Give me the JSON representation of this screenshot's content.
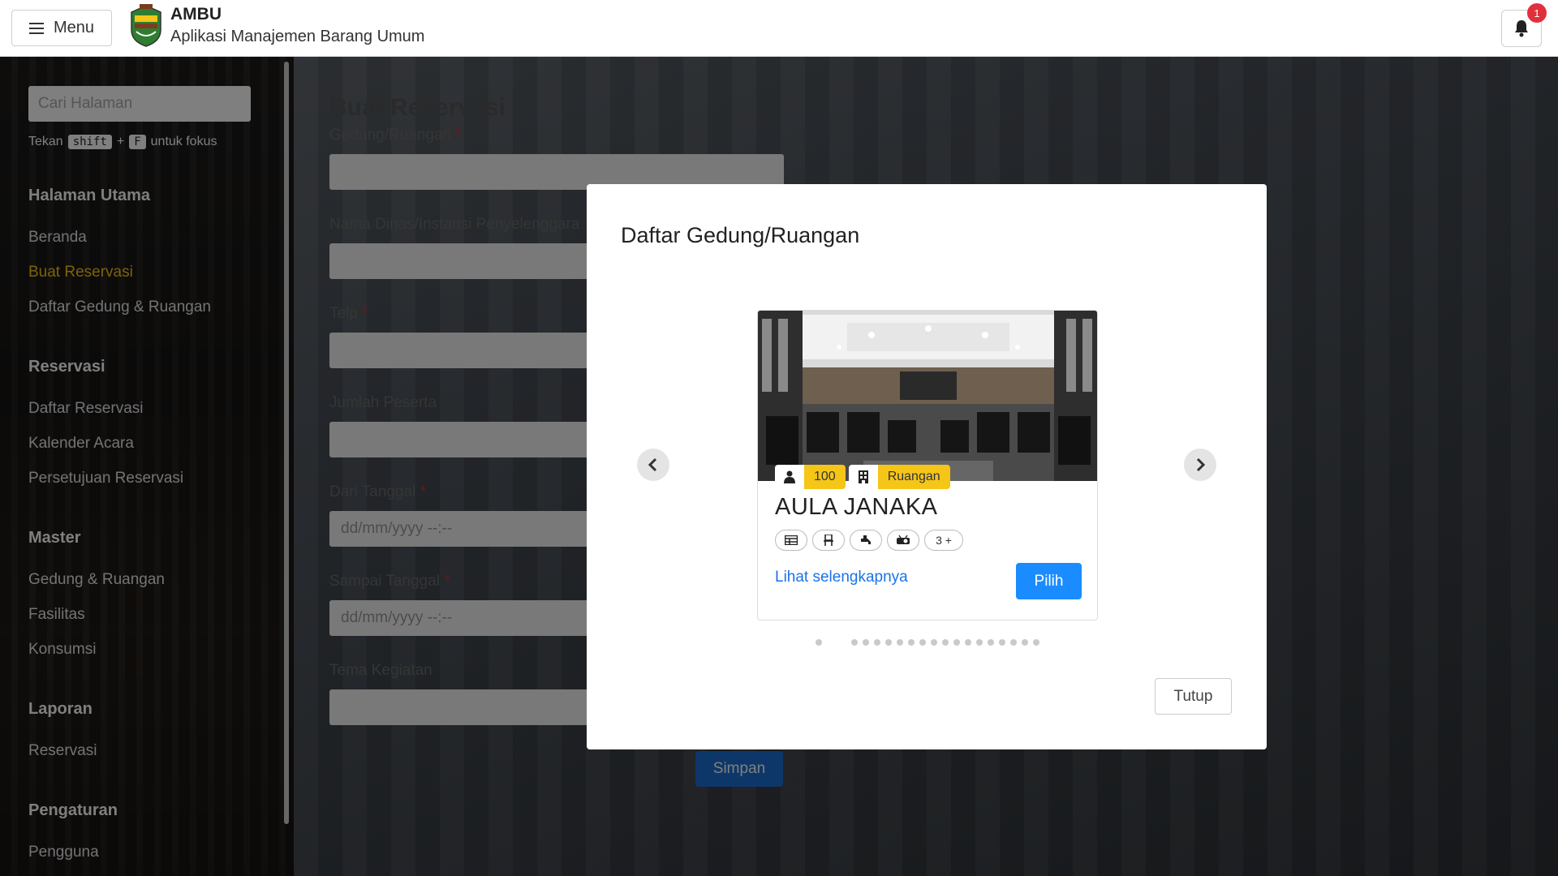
{
  "header": {
    "menu_label": "Menu",
    "app_title": "AMBU",
    "app_subtitle": "Aplikasi Manajemen Barang Umum",
    "notification_count": "1"
  },
  "sidebar": {
    "search_placeholder": "Cari Halaman",
    "hint_prefix": "Tekan",
    "hint_key1": "shift",
    "hint_plus": "+",
    "hint_key2": "F",
    "hint_suffix": "untuk fokus",
    "sections": [
      {
        "title": "Halaman Utama",
        "items": [
          "Beranda",
          "Buat Reservasi",
          "Daftar Gedung & Ruangan"
        ]
      },
      {
        "title": "Reservasi",
        "items": [
          "Daftar Reservasi",
          "Kalender Acara",
          "Persetujuan Reservasi"
        ]
      },
      {
        "title": "Master",
        "items": [
          "Gedung & Ruangan",
          "Fasilitas",
          "Konsumsi"
        ]
      },
      {
        "title": "Laporan",
        "items": [
          "Reservasi"
        ]
      },
      {
        "title": "Pengaturan",
        "items": [
          "Pengguna"
        ]
      }
    ],
    "active_item": "Buat Reservasi"
  },
  "form": {
    "title": "Buat Reservasi",
    "fields": [
      {
        "label": "Gedung/Ruangan",
        "required": true,
        "value": ""
      },
      {
        "label": "Nama Dinas/Instansi Penyelenggara",
        "required": false,
        "value": ""
      },
      {
        "label": "Telp",
        "required": true,
        "value": ""
      },
      {
        "label": "Jumlah Peserta",
        "required": false,
        "value": ""
      },
      {
        "label": "Dari Tanggal",
        "required": true,
        "value": "dd/mm/yyyy --:--"
      },
      {
        "label": "Sampai Tanggal",
        "required": true,
        "value": "dd/mm/yyyy --:--"
      },
      {
        "label": "Tema Kegiatan",
        "required": false,
        "value": ""
      }
    ],
    "required_marker": "*",
    "save_label": "Simpan"
  },
  "modal": {
    "title": "Daftar Gedung/Ruangan",
    "card": {
      "capacity": "100",
      "type": "Ruangan",
      "name": "AULA JANAKA",
      "facility_icons": [
        "table-icon",
        "chair-icon",
        "faucet-icon",
        "projector-icon"
      ],
      "more_label": "3 +",
      "detail_link": "Lihat selengkapnya",
      "select_label": "Pilih"
    },
    "dot_count": 19,
    "close_label": "Tutup"
  },
  "colors": {
    "accent_yellow": "#f5c518",
    "primary_blue": "#1a8cff",
    "link_blue": "#1a73e8",
    "badge_red": "#e0303c"
  }
}
